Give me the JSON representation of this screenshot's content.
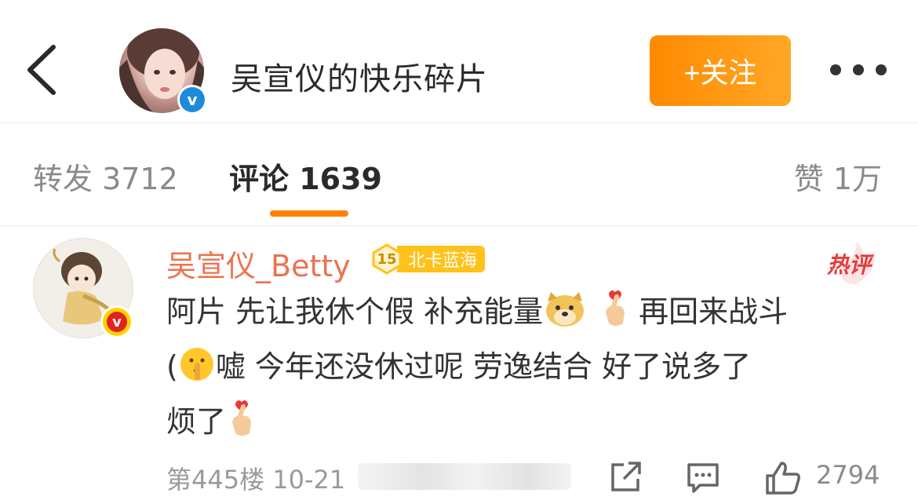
{
  "header": {
    "title": "吴宣仪的快乐碎片",
    "follow_label": "+关注",
    "icons": {
      "back": "chevron-left-icon",
      "more": "more-dots-icon",
      "verified": "verified-v-icon"
    }
  },
  "tabs": [
    {
      "label": "转发 3712",
      "active": false
    },
    {
      "label": "评论 1639",
      "active": true
    },
    {
      "label": "赞 1万",
      "active": false
    }
  ],
  "comment": {
    "username": "吴宣仪_Betty",
    "fan_level": "15",
    "fan_club": "北卡蓝海",
    "hot_tag": "热评",
    "text_line1_a": "阿片 先让我休个假 补充能量",
    "text_line1_b": "再回来战斗",
    "text_line2_a": "(",
    "text_line2_b": "嘘 今年还没休过呢 劳逸结合 好了说多了",
    "text_line3": "烦了",
    "floor_time": "第445楼 10-21",
    "likes": "2794",
    "icons": {
      "share": "share-icon",
      "reply": "comment-icon",
      "like": "thumbs-up-icon",
      "doge": "doge-emoji-icon",
      "heart_hand": "finger-heart-emoji-icon",
      "shush": "shushing-face-emoji-icon"
    }
  },
  "colors": {
    "accent": "#ff8200",
    "username": "#eb7350",
    "hot": "#e8393b",
    "fan_badge": "#ffc21a"
  }
}
